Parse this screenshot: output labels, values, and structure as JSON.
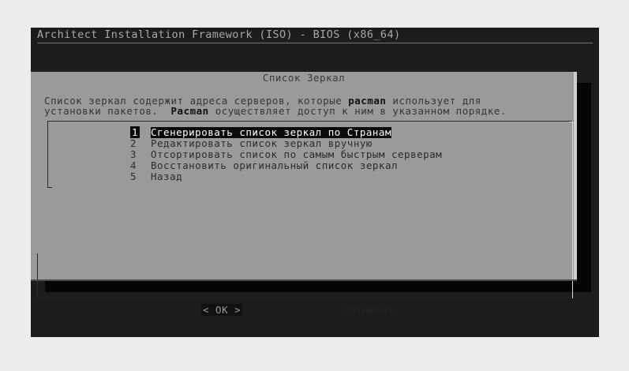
{
  "backtitle": "Architect Installation Framework (ISO) - BIOS (x86_64)",
  "dialog": {
    "title": "Список Зеркал",
    "description_line1_pre": "Список зеркал содержит адреса серверов, которые ",
    "description_line1_bold": "pacman",
    "description_line1_post": " использует для",
    "description_line2_pre": "установки пакетов.  ",
    "description_line2_bold": "Pacman",
    "description_line2_post": " осуществляет доступ к ним в указанном порядке."
  },
  "menu": {
    "items": [
      {
        "num": "1",
        "label": "Сгенерировать список зеркал по Странам"
      },
      {
        "num": "2",
        "label": "Редактировать список зеркал вручную"
      },
      {
        "num": "3",
        "label": "Отсортировать список по самым быстрым серверам"
      },
      {
        "num": "4",
        "label": "Восстановить оригинальный список зеркал"
      },
      {
        "num": "5",
        "label": "Назад"
      }
    ],
    "selected_index": 0
  },
  "buttons": {
    "ok": "< OK >",
    "cancel": "<Отмена>"
  }
}
